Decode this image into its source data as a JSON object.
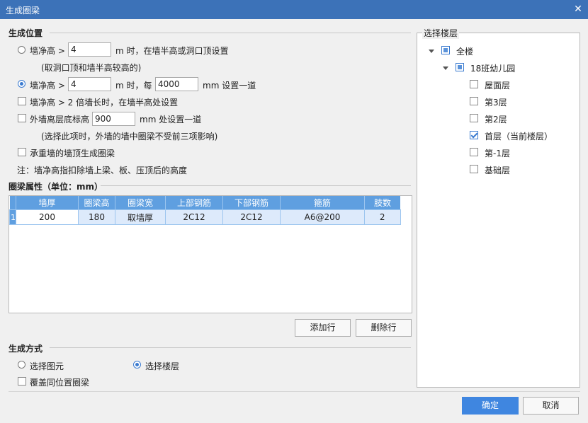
{
  "window": {
    "title": "生成圈梁",
    "close_glyph": "✕"
  },
  "position_section": {
    "title": "生成位置",
    "opt1": {
      "label": "墙净高 >",
      "value": "4",
      "suffix": "m 时，在墙半高或洞口顶设置",
      "note": "(取洞口顶和墙半高较高的)"
    },
    "opt2": {
      "label": "墙净高 >",
      "value": "4",
      "mid": "m 时，每",
      "value2": "4000",
      "suffix": "mm 设置一道"
    },
    "opt3": {
      "label": "墙净高 > 2 倍墙长时，在墙半高处设置"
    },
    "opt4": {
      "label": "外墙离层底标高",
      "value": "900",
      "suffix": "mm 处设置一道",
      "note": "(选择此项时，外墙的墙中圈梁不受前三项影响)"
    },
    "opt5": {
      "label": "承重墙的墙顶生成圈梁"
    },
    "footnote": "注：墙净高指扣除墙上梁、板、压顶后的高度"
  },
  "props_section": {
    "title": "圈梁属性（单位：mm）",
    "columns": [
      "墙厚",
      "圈梁高",
      "圈梁宽",
      "上部钢筋",
      "下部钢筋",
      "箍筋",
      "肢数"
    ],
    "rows": [
      {
        "no": "1",
        "cells": [
          "200",
          "180",
          "取墙厚",
          "2C12",
          "2C12",
          "A6@200",
          "2"
        ]
      }
    ],
    "add_row": "添加行",
    "delete_row": "删除行"
  },
  "method_section": {
    "title": "生成方式",
    "opt_element": "选择图元",
    "opt_floor": "选择楼层",
    "overwrite": "覆盖同位置圈梁"
  },
  "floor_section": {
    "title": "选择楼层",
    "root": "全楼",
    "project": "18班幼儿园",
    "floors": [
      {
        "label": "屋面层",
        "checked": false
      },
      {
        "label": "第3层",
        "checked": false
      },
      {
        "label": "第2层",
        "checked": false
      },
      {
        "label": "首层（当前楼层）",
        "checked": true
      },
      {
        "label": "第-1层",
        "checked": false
      },
      {
        "label": "基础层",
        "checked": false
      }
    ]
  },
  "footer": {
    "ok": "确定",
    "cancel": "取消"
  },
  "colors": {
    "accent": "#3f86e0",
    "titlebar": "#3c72b8",
    "grid_header": "#5f9fe0"
  }
}
